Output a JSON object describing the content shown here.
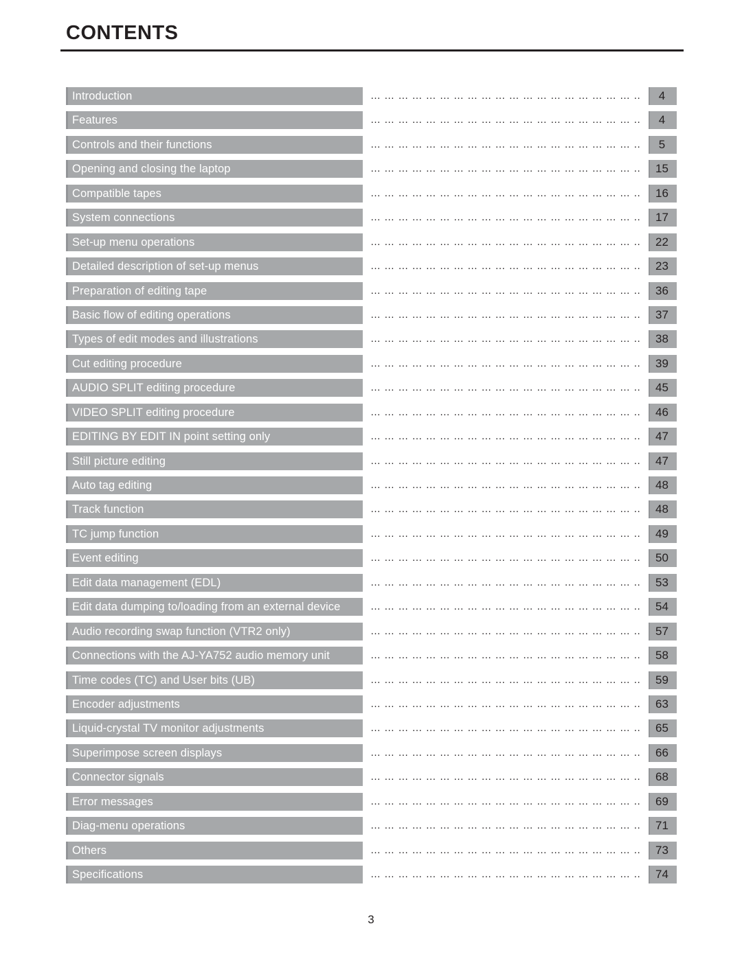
{
  "header": {
    "title": "CONTENTS"
  },
  "footer": {
    "page_number": "3"
  },
  "leader": {
    "dots": "… … … … … … … … … … … … … … … … … … … … … … …"
  },
  "colors": {
    "bar_gray": "#a6a8aa",
    "bar_edge_gray": "#939598",
    "text_dark": "#231f20",
    "entry_text": "#ffffff"
  },
  "toc": {
    "entries": [
      {
        "title": "Introduction",
        "page": "4"
      },
      {
        "title": "Features",
        "page": "4"
      },
      {
        "title": "Controls and their functions",
        "page": "5"
      },
      {
        "title": "Opening and closing the laptop",
        "page": "15"
      },
      {
        "title": "Compatible tapes",
        "page": "16"
      },
      {
        "title": "System connections",
        "page": "17"
      },
      {
        "title": "Set-up menu operations",
        "page": "22"
      },
      {
        "title": "Detailed description of set-up menus",
        "page": "23"
      },
      {
        "title": "Preparation of editing tape",
        "page": "36"
      },
      {
        "title": "Basic flow of editing operations",
        "page": "37"
      },
      {
        "title": "Types of edit modes and illustrations",
        "page": "38"
      },
      {
        "title": "Cut editing procedure",
        "page": "39"
      },
      {
        "title": "AUDIO SPLIT editing procedure",
        "page": "45"
      },
      {
        "title": "VIDEO SPLIT editing procedure",
        "page": "46"
      },
      {
        "title": "EDITING BY EDIT IN point setting only",
        "page": "47"
      },
      {
        "title": "Still picture editing",
        "page": "47"
      },
      {
        "title": "Auto tag editing",
        "page": "48"
      },
      {
        "title": "Track function",
        "page": "48"
      },
      {
        "title": "TC jump function",
        "page": "49"
      },
      {
        "title": "Event editing",
        "page": "50"
      },
      {
        "title": "Edit data management (EDL)",
        "page": "53"
      },
      {
        "title": "Edit data dumping to/loading from an external device",
        "page": "54"
      },
      {
        "title": "Audio recording swap function (VTR2 only)",
        "page": "57"
      },
      {
        "title": "Connections with the AJ-YA752 audio memory unit",
        "page": "58"
      },
      {
        "title": "Time codes (TC) and User bits (UB)",
        "page": "59"
      },
      {
        "title": "Encoder adjustments",
        "page": "63"
      },
      {
        "title": "Liquid-crystal TV monitor adjustments",
        "page": "65"
      },
      {
        "title": "Superimpose screen displays",
        "page": "66"
      },
      {
        "title": "Connector signals",
        "page": "68"
      },
      {
        "title": "Error messages",
        "page": "69"
      },
      {
        "title": "Diag-menu operations",
        "page": "71"
      },
      {
        "title": "Others",
        "page": "73"
      },
      {
        "title": "Specifications",
        "page": "74"
      }
    ]
  }
}
